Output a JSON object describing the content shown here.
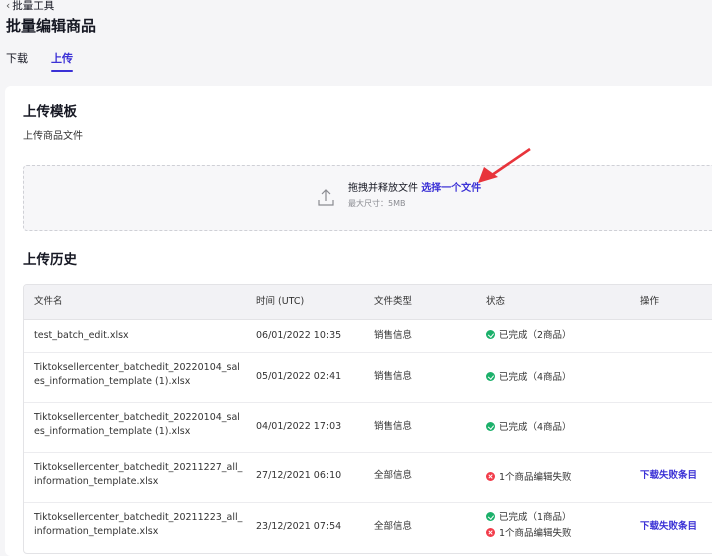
{
  "breadcrumb": {
    "label": "批量工具"
  },
  "page": {
    "title": "批量编辑商品"
  },
  "tabs": [
    {
      "label": "下载",
      "active": false
    },
    {
      "label": "上传",
      "active": true
    }
  ],
  "upload_template": {
    "title": "上传模板",
    "subtitle": "上传商品文件",
    "drop_text": "拖拽并释放文件",
    "choose_link": "选择一个文件",
    "max_size": "最大尺寸：5MB"
  },
  "history": {
    "title": "上传历史",
    "columns": [
      "文件名",
      "时间 (UTC)",
      "文件类型",
      "状态",
      "操作"
    ],
    "rows": [
      {
        "file": "test_batch_edit.xlsx",
        "time": "06/01/2022 10:35",
        "type": "销售信息",
        "status": "已完成（2商品）",
        "status_kind": "ok",
        "action": ""
      },
      {
        "file": "Tiktoksellercenter_batchedit_20220104_sales_information_template (1).xlsx",
        "time": "05/01/2022 02:41",
        "type": "销售信息",
        "status": "已完成（4商品）",
        "status_kind": "ok",
        "action": ""
      },
      {
        "file": "Tiktoksellercenter_batchedit_20220104_sales_information_template (1).xlsx",
        "time": "04/01/2022 17:03",
        "type": "销售信息",
        "status": "已完成（4商品）",
        "status_kind": "ok",
        "action": ""
      },
      {
        "file": "Tiktoksellercenter_batchedit_20211227_all_information_template.xlsx",
        "time": "27/12/2021 06:10",
        "type": "全部信息",
        "status": "1个商品编辑失败",
        "status_kind": "fail",
        "action": "下载失败条目"
      },
      {
        "file": "Tiktoksellercenter_batchedit_20211223_all_information_template.xlsx",
        "time": "23/12/2021 07:54",
        "type": "全部信息",
        "status": "已完成（1商品）",
        "status2": "1个商品编辑失败",
        "status_kind": "ok",
        "action": "下载失败条目"
      }
    ]
  },
  "colors": {
    "accent": "#3b31d6",
    "success": "#1bb06a",
    "error": "#f23c4a",
    "annotation_arrow": "#e8343b"
  }
}
